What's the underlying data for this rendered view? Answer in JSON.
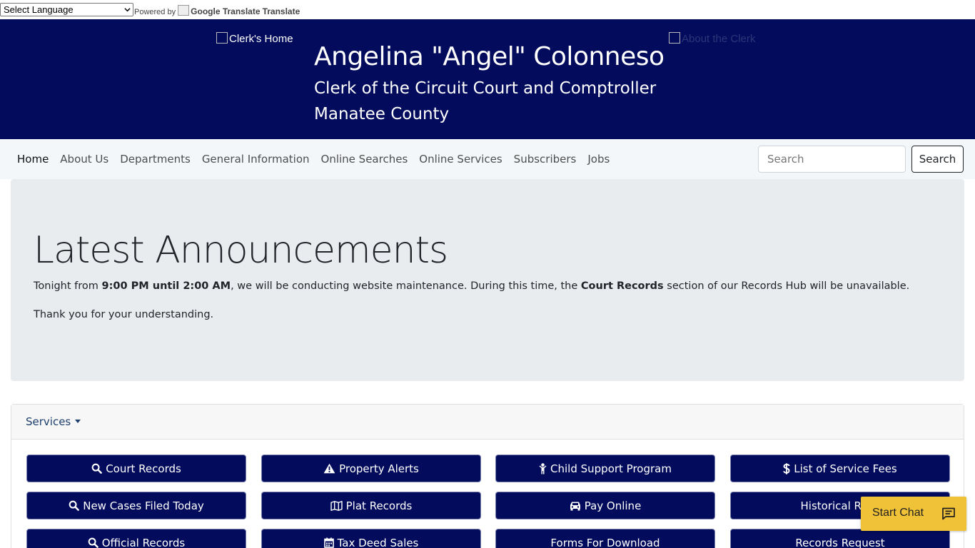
{
  "translate": {
    "select_value": "Select Language",
    "powered_by": "Powered by",
    "google_img_alt": "Google Translate",
    "translate_label": "Translate"
  },
  "header": {
    "home_logo_alt": "Clerk's Home",
    "about_logo_alt": "About the Clerk",
    "name": "Angelina \"Angel\" Colonneso",
    "title": "Clerk of the Circuit Court and Comptroller",
    "county": "Manatee County"
  },
  "nav": {
    "items": [
      "Home",
      "About Us",
      "Departments",
      "General Information",
      "Online Searches",
      "Online Services",
      "Subscribers",
      "Jobs"
    ],
    "search_placeholder": "Search",
    "search_button": "Search"
  },
  "announcement": {
    "title": "Latest Announcements",
    "p1_a": "Tonight from ",
    "p1_b": "9:00 PM until 2:00 AM",
    "p1_c": ", we will be conducting website maintenance. During this time, the ",
    "p1_d": "Court Records",
    "p1_e": " section of our Records Hub will be unavailable.",
    "p2": "Thank you for your understanding."
  },
  "services": {
    "toggle_label": "Services",
    "buttons": [
      {
        "label": "Court Records",
        "icon": "search-icon"
      },
      {
        "label": "Property Alerts",
        "icon": "warning-icon"
      },
      {
        "label": "Child Support Program",
        "icon": "child-icon"
      },
      {
        "label": "List of Service Fees",
        "icon": "dollar-icon"
      },
      {
        "label": "New Cases Filed Today",
        "icon": "search-icon"
      },
      {
        "label": "Plat Records",
        "icon": "map-icon"
      },
      {
        "label": "Pay Online",
        "icon": "car-icon"
      },
      {
        "label": "Historical Reso",
        "icon": ""
      },
      {
        "label": "Official Records",
        "icon": "search-icon"
      },
      {
        "label": "Tax Deed Sales",
        "icon": "calendar-icon"
      },
      {
        "label": "Forms For Download",
        "icon": ""
      },
      {
        "label": "Records Request",
        "icon": ""
      }
    ]
  },
  "chat": {
    "label": "Start Chat",
    "icon": "chat-bubble-icon"
  },
  "colors": {
    "brand_navy": "#020b5c",
    "chat_yellow": "#f0c237",
    "nav_bg": "#f4f7fa",
    "jumbo_bg": "#e9ecef"
  }
}
